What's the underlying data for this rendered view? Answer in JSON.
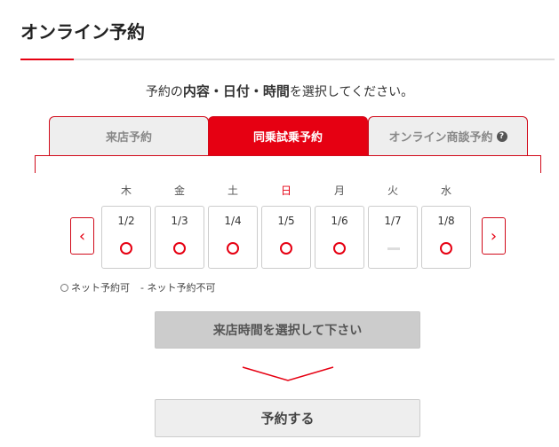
{
  "page": {
    "title": "オンライン予約"
  },
  "instruction": {
    "prefix": "予約の",
    "emphasis": "内容・日付・時間",
    "suffix": "を選択してください。"
  },
  "tabs": [
    {
      "label": "来店予約",
      "active": false
    },
    {
      "label": "同乗試乗予約",
      "active": true
    },
    {
      "label": "オンライン商談予約",
      "active": false,
      "help_icon": "?"
    }
  ],
  "calendar": {
    "prev_icon": "‹",
    "next_icon": "›",
    "days": [
      {
        "dow": "木",
        "date": "1/2",
        "available": true
      },
      {
        "dow": "金",
        "date": "1/3",
        "available": true
      },
      {
        "dow": "土",
        "date": "1/4",
        "available": true
      },
      {
        "dow": "日",
        "date": "1/5",
        "available": true
      },
      {
        "dow": "月",
        "date": "1/6",
        "available": true
      },
      {
        "dow": "火",
        "date": "1/7",
        "available": false
      },
      {
        "dow": "水",
        "date": "1/8",
        "available": true
      }
    ]
  },
  "legend": {
    "available": "ネット予約可",
    "unavailable": "- ネット予約不可"
  },
  "buttons": {
    "select_time": "来店時間を選択して下さい",
    "reserve": "予約する"
  },
  "colors": {
    "accent": "#e60012",
    "sunday": "#e60012"
  }
}
